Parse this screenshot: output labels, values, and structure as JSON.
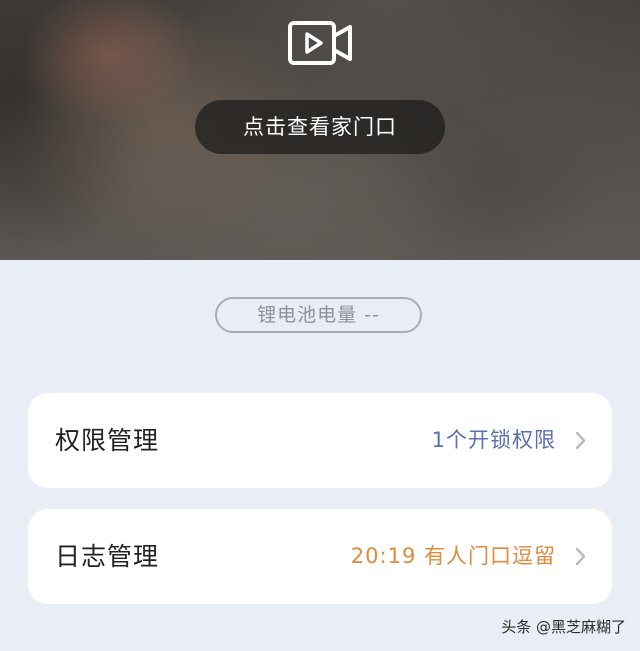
{
  "preview": {
    "camera_icon": "video-camera-play-icon",
    "view_button_label": "点击查看家门口"
  },
  "battery": {
    "label": "锂电池电量 --"
  },
  "cards": {
    "permissions": {
      "title": "权限管理",
      "value": "1个开锁权限",
      "chevron_icon": "chevron-right-icon"
    },
    "logs": {
      "title": "日志管理",
      "value": "20:19 有人门口逗留",
      "chevron_icon": "chevron-right-icon"
    }
  },
  "watermark": {
    "text": "头条 @黑芝麻糊了"
  },
  "colors": {
    "background": "#e9edf5",
    "permission_value": "#5b6fb3",
    "log_value": "#e08a3c",
    "card": "#ffffff"
  }
}
